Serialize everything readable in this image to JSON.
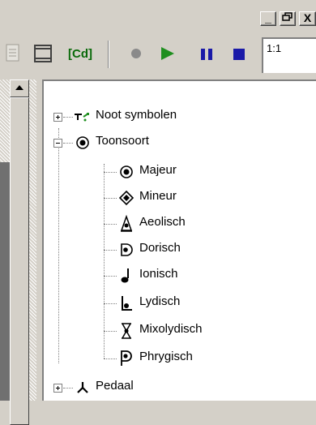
{
  "window": {
    "controls": [
      "_",
      "ȧ",
      "X"
    ]
  },
  "toolbar": {
    "cd_label": "[Cd]",
    "zoom_value": "1:1",
    "icons": [
      "page-icon",
      "frame-icon",
      "cd-icon",
      "record-icon",
      "play-icon",
      "pause-icon",
      "stop-icon"
    ],
    "colors": {
      "play": "#1f8f1f",
      "pause": "#1a1aa8",
      "stop": "#1a1aa8",
      "record": "#8a8a8a",
      "cd": "#0a6a0a"
    }
  },
  "tree": {
    "nodes": [
      {
        "label": "Noot symbolen",
        "icon": "note-symbols-icon",
        "expander": "plus"
      },
      {
        "label": "Toonsoort",
        "icon": "key-circle-icon",
        "expander": "minus"
      },
      {
        "label": "Majeur",
        "icon": "major-icon"
      },
      {
        "label": "Mineur",
        "icon": "minor-icon"
      },
      {
        "label": "Aeolisch",
        "icon": "aeolian-icon"
      },
      {
        "label": "Dorisch",
        "icon": "dorian-icon"
      },
      {
        "label": "Ionisch",
        "icon": "ionian-icon"
      },
      {
        "label": "Lydisch",
        "icon": "lydian-icon"
      },
      {
        "label": "Mixolydisch",
        "icon": "mixolydian-icon"
      },
      {
        "label": "Phrygisch",
        "icon": "phrygian-icon"
      },
      {
        "label": "Pedaal",
        "icon": "pedal-icon",
        "expander": "plus"
      }
    ]
  }
}
